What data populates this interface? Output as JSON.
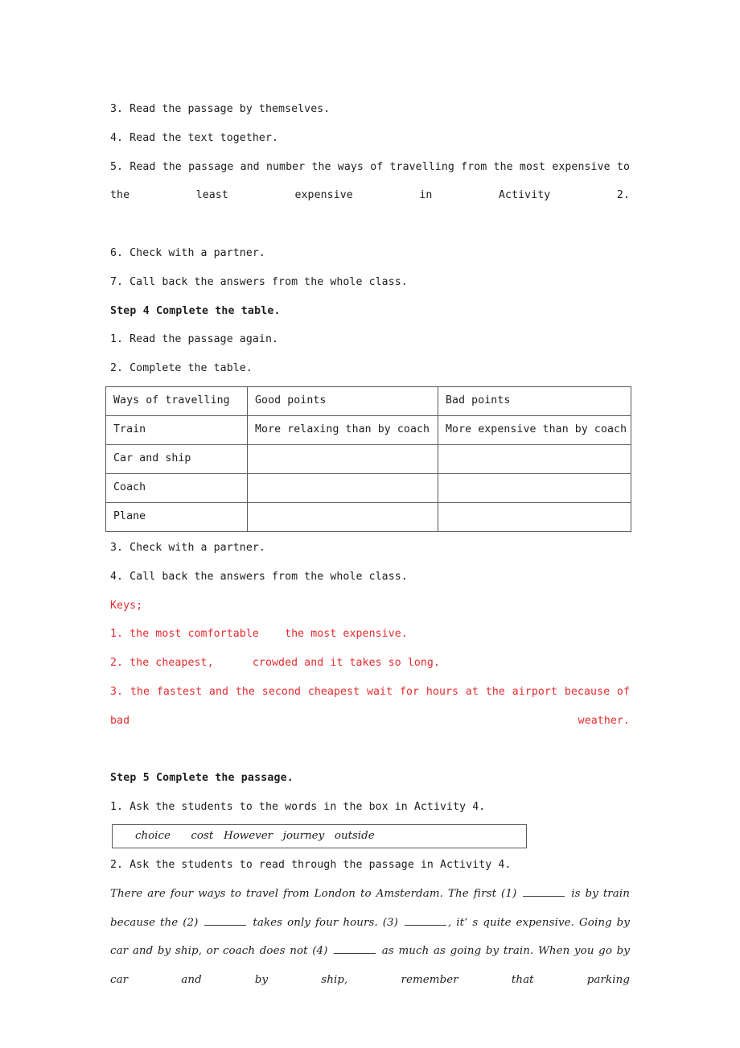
{
  "document": {
    "lesson_steps": [
      "3. Read the passage by themselves.",
      "4. Read the text together.",
      "5. Read the passage and number the ways of travelling from the most expensive to the least expensive in Activity 2.",
      "6. Check with a partner.",
      "7. Call back the answers from the whole class."
    ],
    "step4": {
      "heading": "Step 4 Complete the table.",
      "items": [
        "1. Read the passage again.",
        "2. Complete the table."
      ],
      "table": {
        "headers": [
          "Ways of travelling",
          "Good points",
          "Bad points"
        ],
        "rows": [
          {
            "way": "Train",
            "good": "More relaxing than by coach",
            "bad": "More expensive than by coach"
          },
          {
            "way": "Car and ship",
            "good": "",
            "bad": ""
          },
          {
            "way": "Coach",
            "good": "",
            "bad": ""
          },
          {
            "way": "Plane",
            "good": "",
            "bad": ""
          }
        ]
      },
      "after_table": [
        "3. Check with a partner.",
        "4. Call back the answers from the whole class."
      ]
    },
    "keys": {
      "label": "Keys;",
      "color": "#e52a2e",
      "answers": [
        "1. the most comfortable    the most expensive.",
        "2. the cheapest,      crowded and it takes so long.",
        "3. the fastest and the second cheapest    wait for hours at the airport because of bad weather."
      ]
    },
    "step5": {
      "heading": "Step 5 Complete the passage.",
      "item1": "1. Ask the students to the words in the box in Activity 4.",
      "word_box": "choice      cost   However   journey   outside",
      "item2": "2. Ask the students to read through the passage in Activity 4.",
      "passage_parts": {
        "p1": "There are four ways to travel from London to Amsterdam. The first (1) ",
        "p2": " is by train because the (2) ",
        "p3": " takes only four hours. (3) ",
        "p4": ", it’ s quite expensive. Going by car and by ship, or coach does not (4) ",
        "p5": " as much as going by train. When you go by car and by ship, remember that parking"
      }
    }
  }
}
